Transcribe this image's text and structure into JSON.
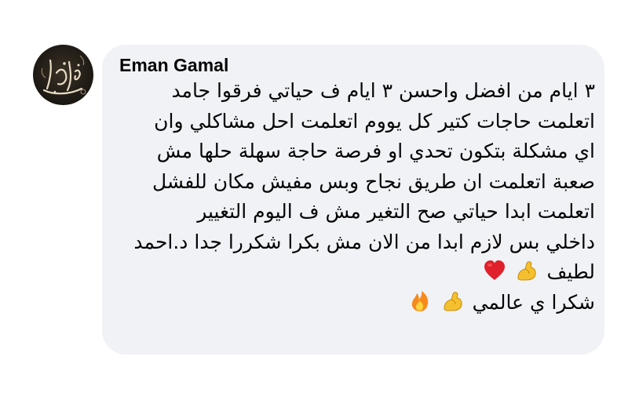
{
  "comment": {
    "author": "Eman Gamal",
    "avatar_icon": "avatar-calligraphy-icon",
    "lines": [
      "٣ ايام من افضل واحسن ٣ ايام ف حياتي فرقوا جامد",
      "اتعلمت حاجات كتير كل يووم اتعلمت احل مشاكلي وان",
      "اي مشكلة بتكون تحدي او فرصة حاجة سهلة حلها مش",
      "صعبة اتعلمت ان طريق نجاح وبس مفيش مكان للفشل",
      "اتعلمت ابدا حياتي صح التغير مش ف اليوم التغيير",
      "داخلي بس لازم ابدا من الان مش بكرا شكررا جدا د.احمد"
    ],
    "line7_text": "لطيف",
    "line8_text": "شكرا ي عالمي",
    "emojis": {
      "line7": [
        "flexed-biceps-icon",
        "red-heart-icon"
      ],
      "line8": [
        "flexed-biceps-icon",
        "fire-icon"
      ]
    },
    "colors": {
      "bubble": "#f0f2f5",
      "text": "#050505",
      "heart": "#e0202a",
      "biceps": "#f5c030",
      "fire": "#f58a1a"
    }
  }
}
